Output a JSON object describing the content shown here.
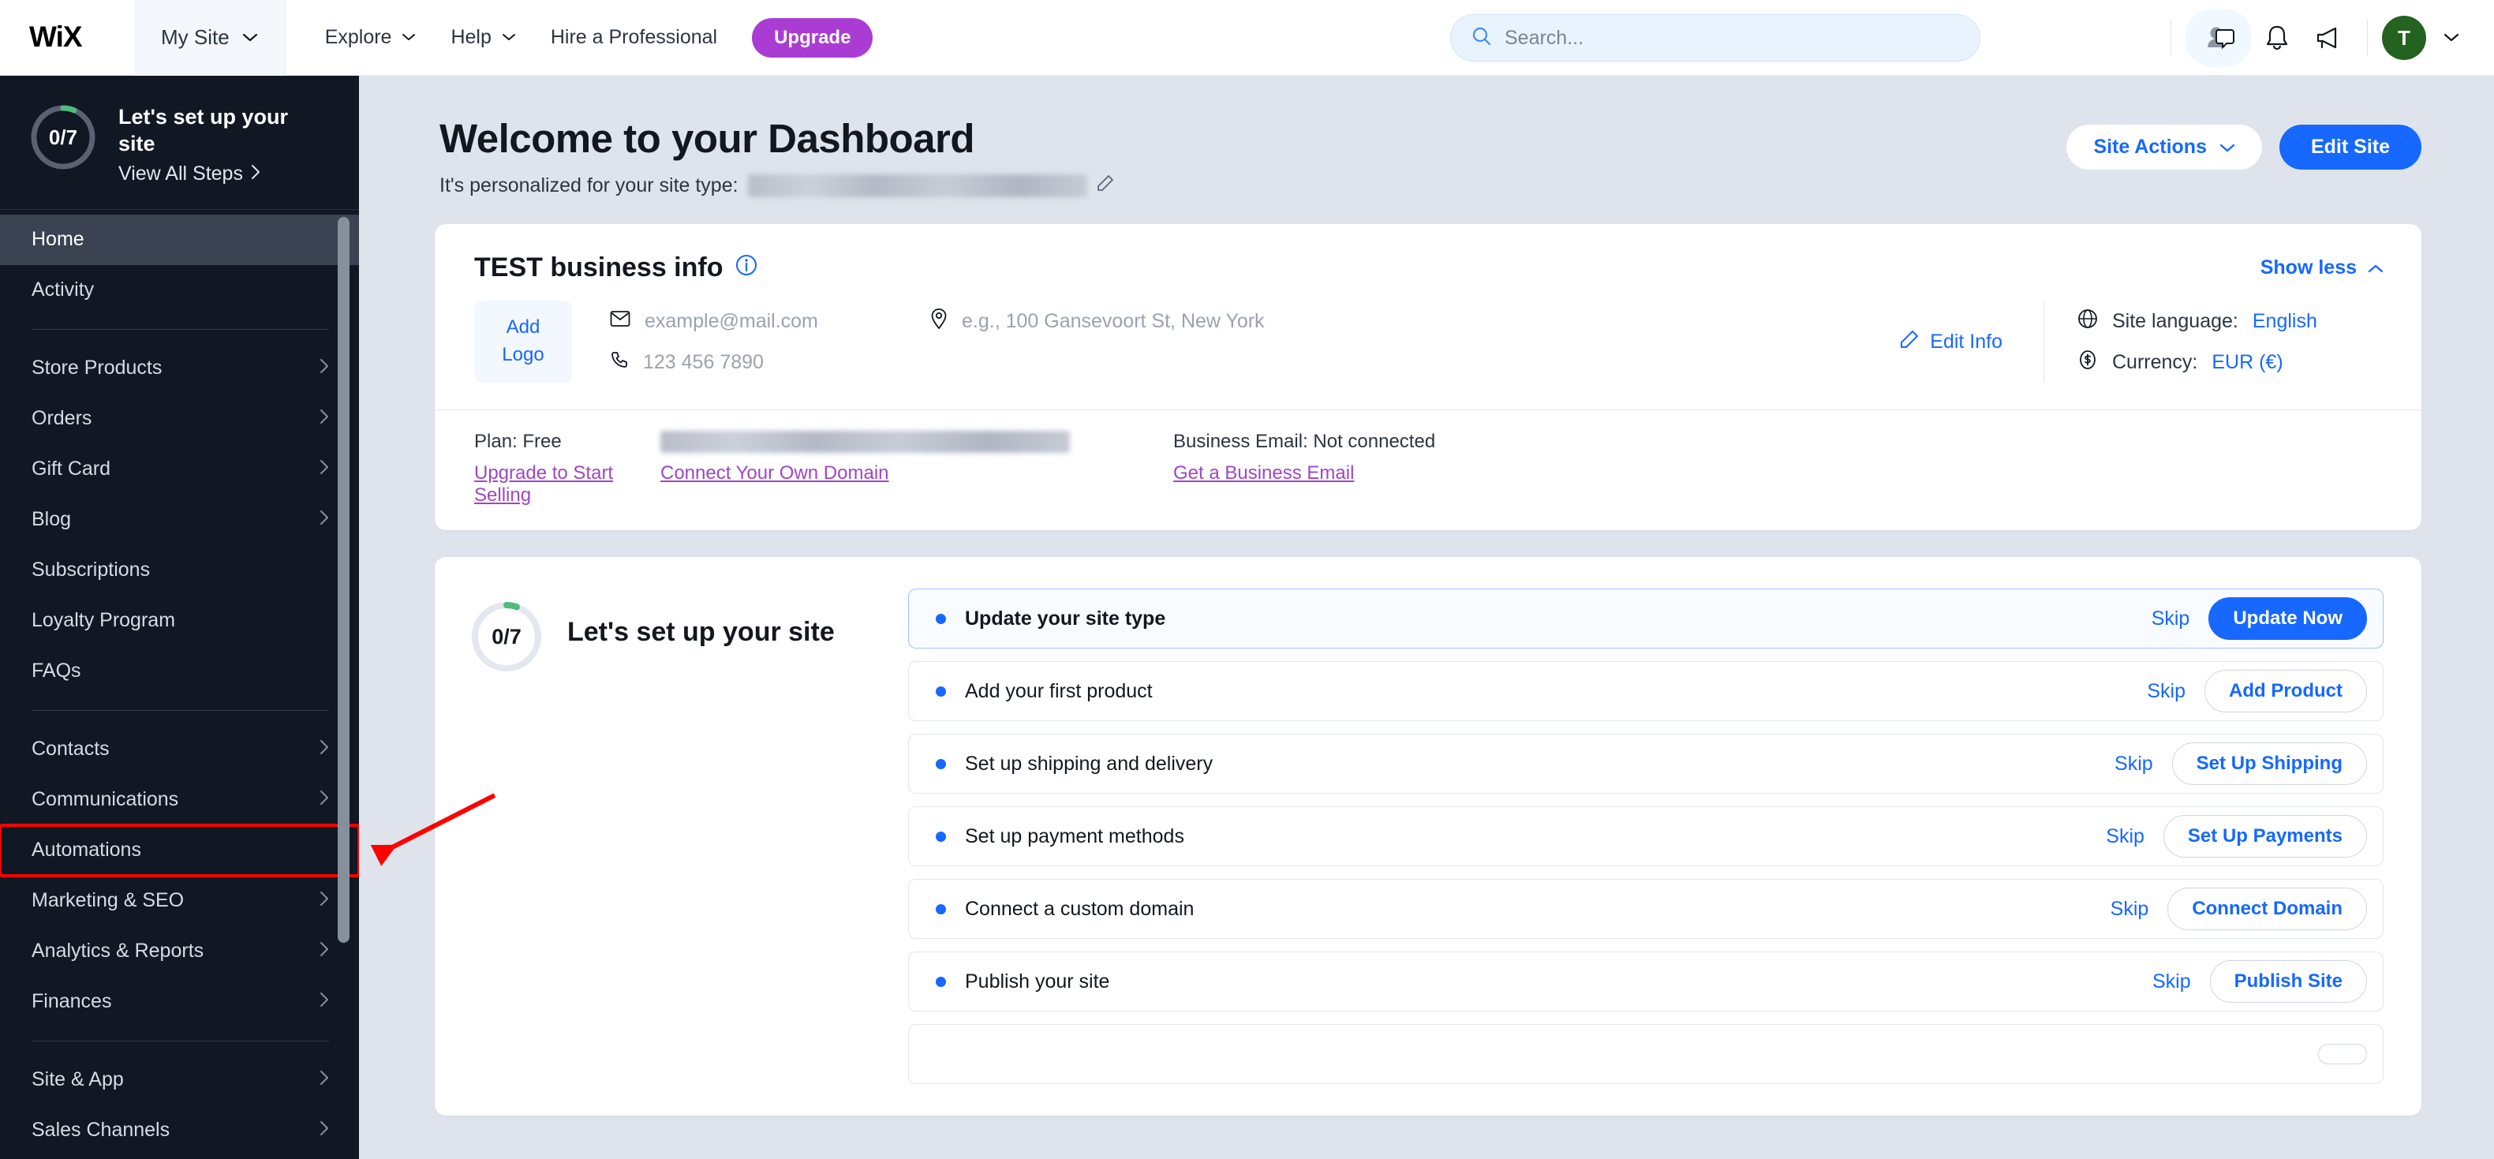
{
  "topbar": {
    "logo_text": "WiX",
    "site_tab": {
      "label": "My Site",
      "icon": "chevron-down-icon"
    },
    "nav": [
      {
        "label": "Explore",
        "has_chevron": true
      },
      {
        "label": "Help",
        "has_chevron": true
      },
      {
        "label": "Hire a Professional",
        "has_chevron": false
      }
    ],
    "upgrade_label": "Upgrade",
    "search": {
      "placeholder": "Search...",
      "value": "",
      "icon": "search-icon"
    },
    "icons": [
      "account-chat-icon",
      "bell-icon",
      "megaphone-icon"
    ],
    "avatar_initial": "T"
  },
  "sidebar": {
    "setup": {
      "progress_label": "0/7",
      "title": "Let's set up your site",
      "link_label": "View All Steps",
      "completed": 0,
      "total": 7
    },
    "items": [
      {
        "label": "Home",
        "chevron": false,
        "active": true,
        "highlighted": false
      },
      {
        "label": "Activity",
        "chevron": false,
        "active": false,
        "highlighted": false
      },
      {
        "separator_after": true
      },
      {
        "label": "Store Products",
        "chevron": true,
        "active": false,
        "highlighted": false
      },
      {
        "label": "Orders",
        "chevron": true,
        "active": false,
        "highlighted": false
      },
      {
        "label": "Gift Card",
        "chevron": true,
        "active": false,
        "highlighted": false
      },
      {
        "label": "Blog",
        "chevron": true,
        "active": false,
        "highlighted": false
      },
      {
        "label": "Subscriptions",
        "chevron": false,
        "active": false,
        "highlighted": false
      },
      {
        "label": "Loyalty Program",
        "chevron": false,
        "active": false,
        "highlighted": false
      },
      {
        "label": "FAQs",
        "chevron": false,
        "active": false,
        "highlighted": false
      },
      {
        "separator_after": true
      },
      {
        "label": "Contacts",
        "chevron": true,
        "active": false,
        "highlighted": false
      },
      {
        "label": "Communications",
        "chevron": true,
        "active": false,
        "highlighted": false
      },
      {
        "label": "Automations",
        "chevron": false,
        "active": false,
        "highlighted": true
      },
      {
        "label": "Marketing & SEO",
        "chevron": true,
        "active": false,
        "highlighted": false
      },
      {
        "label": "Analytics & Reports",
        "chevron": true,
        "active": false,
        "highlighted": false
      },
      {
        "label": "Finances",
        "chevron": true,
        "active": false,
        "highlighted": false
      },
      {
        "separator_after": true
      },
      {
        "label": "Site & App",
        "chevron": true,
        "active": false,
        "highlighted": false
      },
      {
        "label": "Sales Channels",
        "chevron": true,
        "active": false,
        "highlighted": false
      }
    ]
  },
  "page": {
    "title": "Welcome to your Dashboard",
    "subtitle_prefix": "It's personalized for your site type:",
    "site_type_redacted": "Wellness services Shop Fitness Studio",
    "edit_icon": "pencil-icon",
    "site_actions_label": "Site Actions",
    "edit_site_label": "Edit Site"
  },
  "business_card": {
    "title": "TEST business info",
    "info_icon": "info-icon",
    "show_less_label": "Show less",
    "add_logo_line1": "Add",
    "add_logo_line2": "Logo",
    "email_placeholder": "example@mail.com",
    "phone_placeholder": "123 456 7890",
    "address_placeholder": "e.g., 100 Gansevoort St, New York",
    "edit_info_label": "Edit Info",
    "site_language_label": "Site language:",
    "site_language_value": "English",
    "currency_label": "Currency:",
    "currency_value": "EUR (€)",
    "plan_label": "Plan: Free",
    "plan_link": "Upgrade to Start Selling",
    "domain_redacted": "Domain: https://mailfortesla3.wixsite.com/my-site",
    "domain_link": "Connect Your Own Domain",
    "email_status": "Business Email: Not connected",
    "email_link": "Get a Business Email"
  },
  "setup_checklist": {
    "progress_label": "0/7",
    "title": "Let's set up your site",
    "skip_label": "Skip",
    "tasks": [
      {
        "label": "Update your site type",
        "button": "Update Now",
        "active": true
      },
      {
        "label": "Add your first product",
        "button": "Add Product",
        "active": false
      },
      {
        "label": "Set up shipping and delivery",
        "button": "Set Up Shipping",
        "active": false
      },
      {
        "label": "Set up payment methods",
        "button": "Set Up Payments",
        "active": false
      },
      {
        "label": "Connect a custom domain",
        "button": "Connect Domain",
        "active": false
      },
      {
        "label": "Publish your site",
        "button": "Publish Site",
        "active": false
      },
      {
        "label": "",
        "button": "",
        "active": false
      }
    ]
  },
  "annotation": {
    "arrow_color": "#ff0000",
    "highlight_color": "#ff0000",
    "target": "Automations"
  },
  "colors": {
    "accent_blue": "#1668ff",
    "upgrade_purple": "#aa3cd4",
    "link_purple": "#9f46c4",
    "sidebar_bg": "#111723",
    "page_bg": "#dfe3ec"
  }
}
